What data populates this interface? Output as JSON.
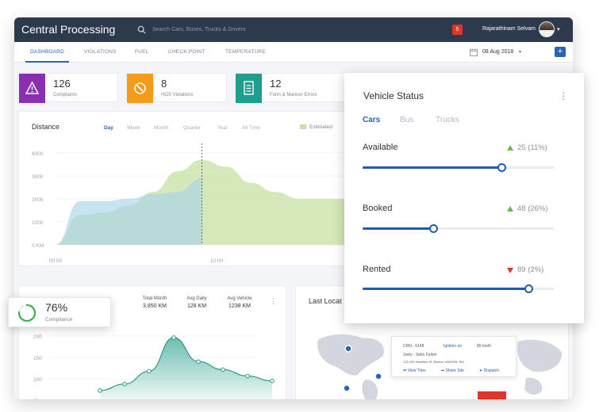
{
  "app": {
    "title": "Central Processing",
    "search_placeholder": "Search Cars, Buses, Trucks & Drivers",
    "notification_count": "5",
    "user_name": "Rajarathinam Selvam"
  },
  "tabs": [
    "DASHBOARD",
    "VIOLATIONS",
    "FUEL",
    "CHECK POINT",
    "TEMPERATURE"
  ],
  "active_tab": "DASHBOARD",
  "date": "08 Aug 2018",
  "add_label": "+",
  "kpis": [
    {
      "value": "126",
      "label": "Complaints",
      "color": "#8a2fb0"
    },
    {
      "value": "8",
      "label": "HOS Violations",
      "color": "#f59b19"
    },
    {
      "value": "12",
      "label": "Form & Manner Errors",
      "color": "#1f9e8e"
    }
  ],
  "distance_chart": {
    "title": "Distance",
    "ranges": [
      "Day",
      "Week",
      "Month",
      "Quarter",
      "Year",
      "All Time"
    ],
    "active_range": "Day",
    "legend": "Estimated",
    "y_ticks": [
      "4000",
      "3000",
      "2000",
      "1000",
      "0 KM"
    ],
    "x_ticks": [
      "00:00",
      "12:00"
    ]
  },
  "chart_data": {
    "type": "area",
    "x": [
      0,
      2,
      4,
      6,
      8,
      10,
      12,
      14,
      16,
      18,
      20,
      22,
      24
    ],
    "series": [
      {
        "values": [
          0,
          1300,
          1400,
          1700,
          2300,
          3200,
          3700,
          3400,
          2700,
          2300,
          2000,
          2000,
          2000
        ]
      },
      {
        "values": [
          0,
          1900,
          1900,
          2000,
          2200,
          2300,
          2900
        ]
      }
    ],
    "ylim": [
      0,
      4000
    ]
  },
  "stats": [
    {
      "label": "Total Month",
      "value": "3,850 KM"
    },
    {
      "label": "Avg Daily",
      "value": "128 KM"
    },
    {
      "label": "Avg Vehicle",
      "value": "1238 KM"
    }
  ],
  "compliance_chart": {
    "y_ticks": [
      "200",
      "150",
      "100",
      "50"
    ]
  },
  "map": {
    "title": "Last Locat",
    "popup": {
      "id": "CRN - 5148",
      "status": "Ignition on",
      "speed": "80 km/h",
      "driver": "Joely - Selin Fulton",
      "address": "123 100 Hamilton St, Boston, MA0295, RIA",
      "view_trips": "View Trips",
      "share_site": "Share Site",
      "dispatch": "Dispatch"
    }
  },
  "compliance_card": {
    "value": "76%",
    "label": "Compliance",
    "fraction": 0.76
  },
  "vehicle_status": {
    "title": "Vehicle Status",
    "tabs": [
      "Cars",
      "Bus",
      "Trucks"
    ],
    "active_tab": "Cars",
    "items": [
      {
        "label": "Available",
        "value": "25 (11%)",
        "trend": "up",
        "level": 0.73
      },
      {
        "label": "Booked",
        "value": "48 (26%)",
        "trend": "up",
        "level": 0.37
      },
      {
        "label": "Rented",
        "value": "89 (2%)",
        "trend": "down",
        "level": 0.87
      }
    ]
  }
}
